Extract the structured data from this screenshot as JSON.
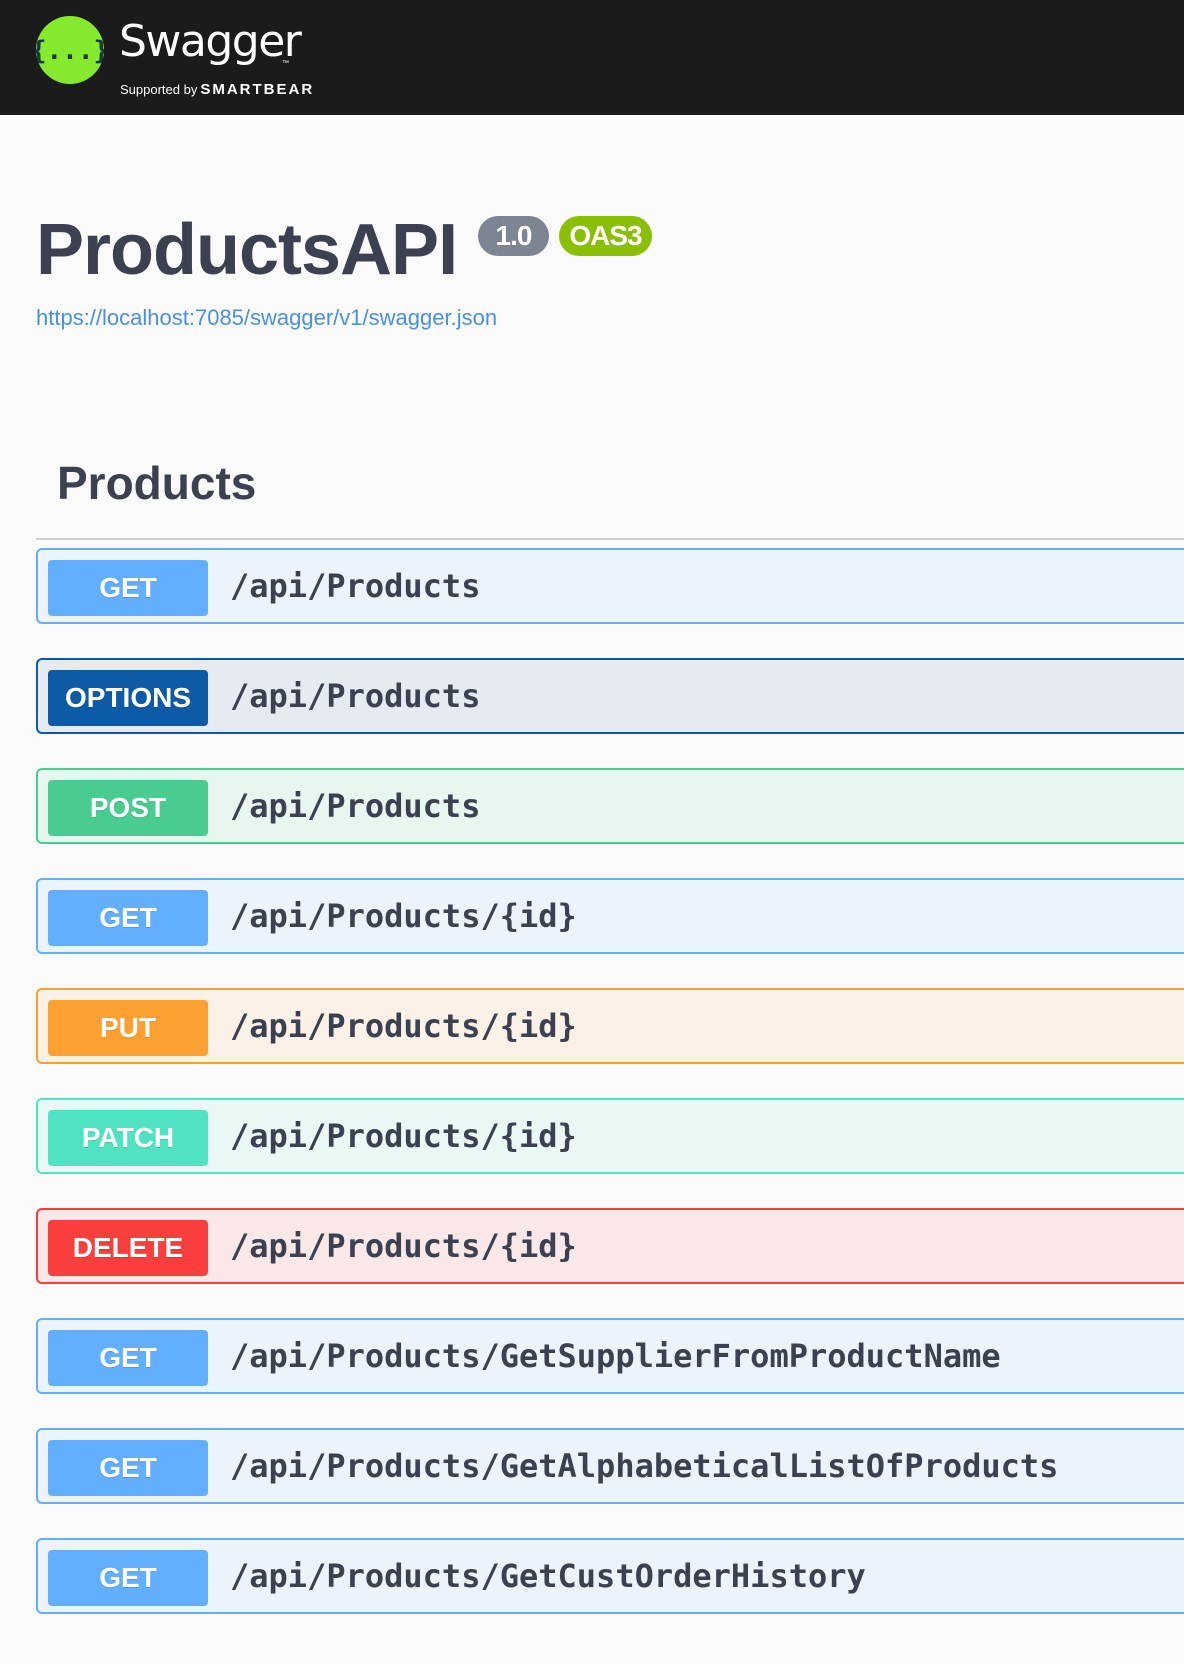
{
  "topbar": {
    "logo_text": "Swagger",
    "logo_tm": "™",
    "supported_by": "Supported by",
    "brand": "SMARTBEAR",
    "logo_glyph": "{...}",
    "logo_color": "#85ea2d"
  },
  "info": {
    "title": "ProductsAPI",
    "version": "1.0",
    "oas_badge": "OAS3",
    "spec_url": "https://localhost:7085/swagger/v1/swagger.json"
  },
  "section": {
    "title": "Products"
  },
  "operations": [
    {
      "method": "GET",
      "path": "/api/Products"
    },
    {
      "method": "OPTIONS",
      "path": "/api/Products"
    },
    {
      "method": "POST",
      "path": "/api/Products"
    },
    {
      "method": "GET",
      "path": "/api/Products/{id}"
    },
    {
      "method": "PUT",
      "path": "/api/Products/{id}"
    },
    {
      "method": "PATCH",
      "path": "/api/Products/{id}"
    },
    {
      "method": "DELETE",
      "path": "/api/Products/{id}"
    },
    {
      "method": "GET",
      "path": "/api/Products/GetSupplierFromProductName"
    },
    {
      "method": "GET",
      "path": "/api/Products/GetAlphabeticalListOfProducts"
    },
    {
      "method": "GET",
      "path": "/api/Products/GetCustOrderHistory"
    }
  ],
  "method_colors": {
    "GET": "#61affe",
    "OPTIONS": "#0d5aa7",
    "POST": "#49cc90",
    "PUT": "#fca130",
    "PATCH": "#50e3c2",
    "DELETE": "#f93e3e"
  }
}
